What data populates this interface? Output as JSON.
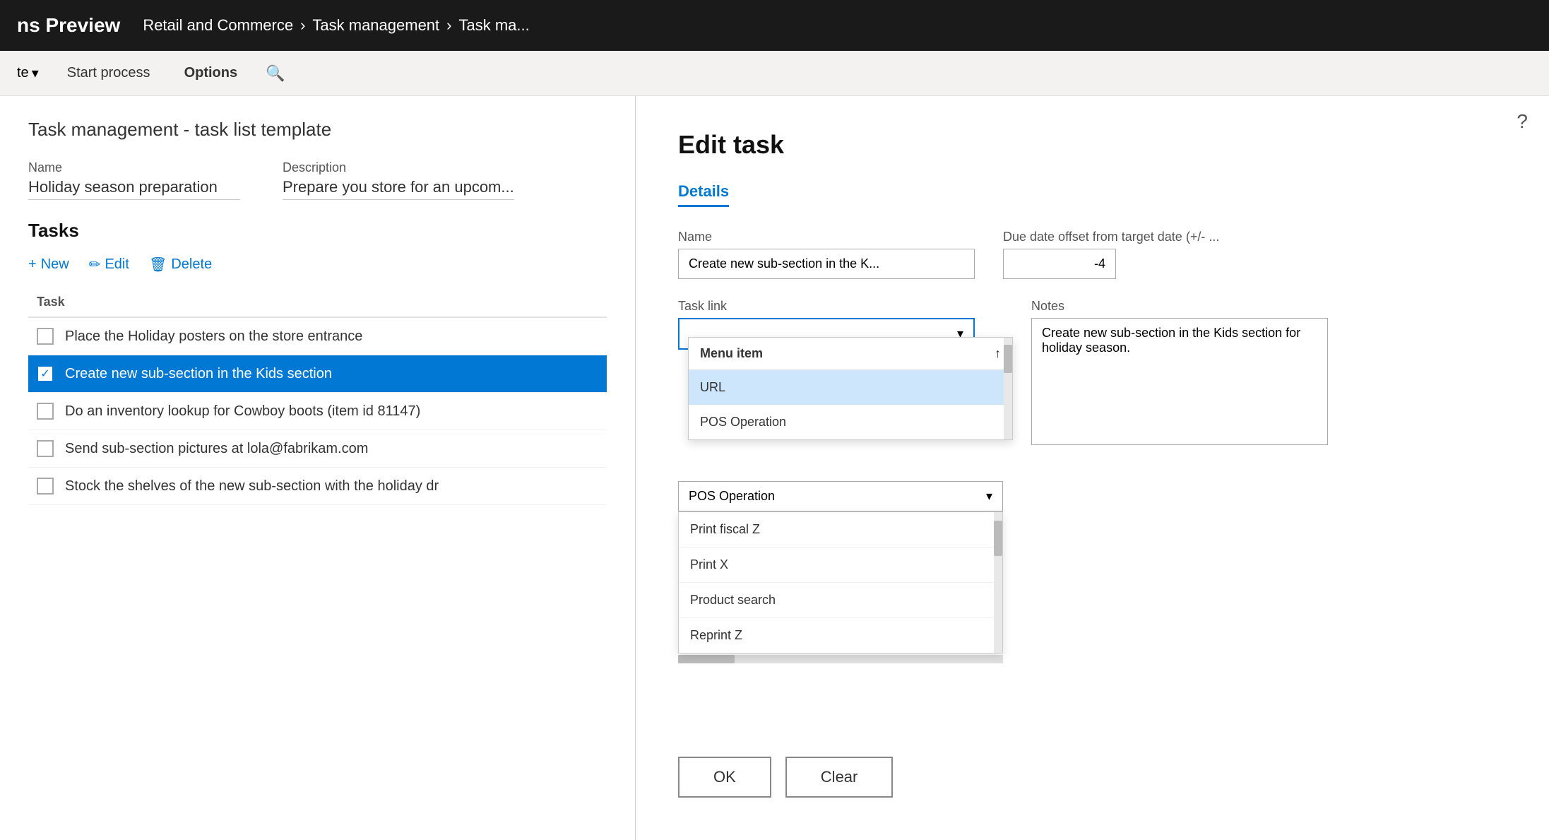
{
  "topNav": {
    "appTitle": "ns Preview",
    "breadcrumb": [
      {
        "label": "Retail and Commerce"
      },
      {
        "label": "Task management"
      },
      {
        "label": "Task ma..."
      }
    ]
  },
  "actionBar": {
    "updateBtn": "te",
    "startProcessBtn": "Start process",
    "optionsBtn": "Options",
    "searchPlaceholder": ""
  },
  "leftPanel": {
    "pageTitle": "Task management - task list template",
    "nameLabel": "Name",
    "nameValue": "Holiday season preparation",
    "descriptionLabel": "Description",
    "descriptionValue": "Prepare you store for an upcom...",
    "tasksSectionTitle": "Tasks",
    "newBtn": "+ New",
    "editBtn": "Edit",
    "deleteBtn": "Delete",
    "taskListHeader": "Task",
    "tasks": [
      {
        "label": "Place the Holiday posters on the store entrance",
        "checked": false,
        "selected": false
      },
      {
        "label": "Create new sub-section in the Kids section",
        "checked": true,
        "selected": true
      },
      {
        "label": "Do an inventory lookup for Cowboy boots (item id 81147)",
        "checked": false,
        "selected": false
      },
      {
        "label": "Send sub-section pictures at lola@fabrikam.com",
        "checked": false,
        "selected": false
      },
      {
        "label": "Stock the shelves of the new sub-section with the holiday dr",
        "checked": false,
        "selected": false
      }
    ]
  },
  "editTask": {
    "title": "Edit task",
    "detailsTab": "Details",
    "nameLabel": "Name",
    "nameValue": "Create new sub-section in the K...",
    "dueDateLabel": "Due date offset from target date (+/- ...",
    "dueDateValue": "-4",
    "taskLinkLabel": "Task link",
    "taskLinkValue": "",
    "notesLabel": "Notes",
    "notesValue": "Create new sub-section in the Kids section for holiday season.",
    "selectedLinkType": "POS Operation",
    "linkTypeDropdown": {
      "items": [
        {
          "label": "Menu item",
          "selected": false
        },
        {
          "label": "URL",
          "selected": true
        },
        {
          "label": "POS Operation",
          "selected": false
        }
      ]
    },
    "posOperationDropdown": {
      "header": "Menu item",
      "upArrow": "↑",
      "items": [
        {
          "label": "Print fiscal Z",
          "selected": false
        },
        {
          "label": "Print X",
          "selected": false
        },
        {
          "label": "Product search",
          "selected": false
        },
        {
          "label": "Reprint Z",
          "selected": false
        }
      ]
    },
    "okBtn": "OK",
    "clearBtn": "Clear"
  },
  "icons": {
    "chevronDown": "▾",
    "checkmark": "✓",
    "searchIcon": "🔍",
    "editIcon": "✏",
    "deleteIcon": "🗑",
    "helpIcon": "?",
    "upArrow": "↑"
  }
}
